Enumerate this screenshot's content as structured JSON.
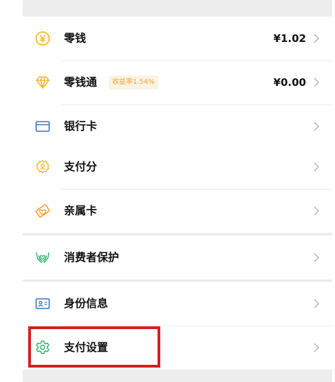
{
  "wallet": {
    "change": {
      "label": "零钱",
      "value": "¥1.02",
      "icon": "coin-icon"
    },
    "fund": {
      "label": "零钱通",
      "badge": "收益率1.54%",
      "value": "¥0.00",
      "icon": "diamond-icon"
    },
    "bank_card": {
      "label": "银行卡",
      "icon": "card-icon"
    }
  },
  "services": {
    "pay_score": {
      "label": "支付分",
      "icon": "score-badge-icon"
    },
    "family_card": {
      "label": "亲属卡",
      "icon": "family-card-icon"
    }
  },
  "protection": {
    "consumer_protection": {
      "label": "消费者保护",
      "icon": "hands-heart-icon"
    }
  },
  "settings": {
    "identity_info": {
      "label": "身份信息",
      "icon": "id-card-icon"
    },
    "pay_settings": {
      "label": "支付设置",
      "icon": "gear-icon"
    }
  },
  "colors": {
    "green": "#2aae67",
    "gold": "#f4b62e",
    "orange": "#f59a23",
    "blue": "#3d6fb6",
    "highlight_red": "#d81e1e",
    "badge_text": "#f3a33e",
    "badge_bg": "#fdf3e3"
  }
}
